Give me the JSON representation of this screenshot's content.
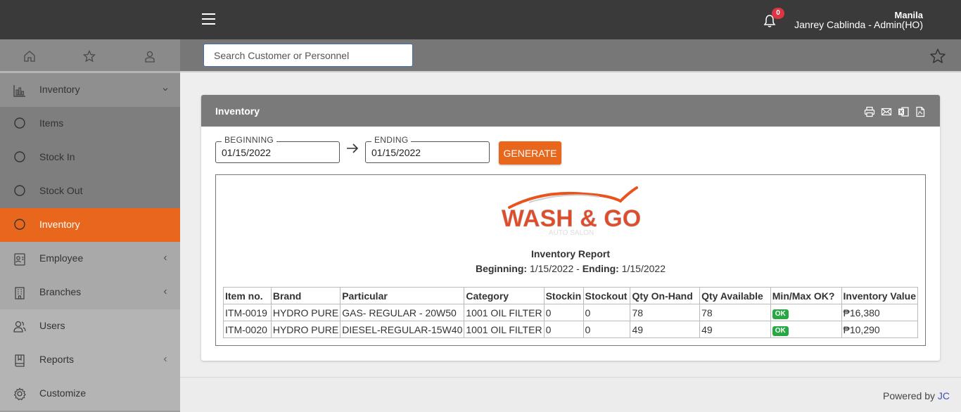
{
  "header": {
    "notification_count": "0",
    "user_city": "Manila",
    "user_name": "Janrey Cablinda - Admin(HO)",
    "menu_icon": "hamburger-menu-icon",
    "bell_icon": "bell-icon"
  },
  "search": {
    "placeholder": "Search Customer or Personnel",
    "value": ""
  },
  "sidebar": {
    "top_icons": [
      "home-icon",
      "star-icon",
      "user-icon"
    ],
    "items": [
      {
        "label": "Inventory",
        "icon": "chart-icon",
        "expanded": true
      },
      {
        "label": "Items",
        "icon": "circle-icon"
      },
      {
        "label": "Stock In",
        "icon": "circle-icon"
      },
      {
        "label": "Stock Out",
        "icon": "circle-icon"
      },
      {
        "label": "Inventory",
        "icon": "circle-icon",
        "active": true
      },
      {
        "label": "Employee",
        "icon": "employee-badge-icon"
      },
      {
        "label": "Branches",
        "icon": "building-icon"
      },
      {
        "label": "Users",
        "icon": "users-icon"
      },
      {
        "label": "Reports",
        "icon": "book-icon"
      },
      {
        "label": "Customize",
        "icon": "gear-icon"
      }
    ]
  },
  "card": {
    "title": "Inventory",
    "toolbar_icons": [
      "print-icon",
      "email-icon",
      "excel-icon",
      "pdf-icon"
    ]
  },
  "filters": {
    "beginning_label": "BEGINNING",
    "beginning_value": "01/15/2022",
    "ending_label": "ENDING",
    "ending_value": "01/15/2022",
    "generate_label": "GENERATE"
  },
  "report": {
    "logo_text": "WASH & GO",
    "logo_subtext": "AUTO SALON",
    "title": "Inventory Report",
    "beginning_label": "Beginning:",
    "beginning_value": "1/15/2022",
    "separator": "-",
    "ending_label": "Ending:",
    "ending_value": "1/15/2022",
    "columns": [
      "Item no.",
      "Brand",
      "Particular",
      "Category",
      "Stockin",
      "Stockout",
      "Qty On-Hand",
      "Qty Available",
      "Min/Max OK?",
      "Inventory Value"
    ],
    "rows": [
      [
        "ITM-0019",
        "HYDRO PURE",
        "GAS- REGULAR - 20W50",
        "1001 OIL FILTER",
        "0",
        "0",
        "78",
        "78",
        "OK",
        "₱16,380"
      ],
      [
        "ITM-0020",
        "HYDRO PURE",
        "DIESEL-REGULAR-15W40",
        "1001 OIL FILTER",
        "0",
        "0",
        "49",
        "49",
        "OK",
        "₱10,290"
      ]
    ]
  },
  "footer": {
    "powered_text": "Powered by",
    "powered_link": "JC"
  },
  "colors": {
    "accent": "#e8671c",
    "topbar": "#3a3a3a",
    "ok_badge": "#28a745",
    "badge": "#dc3545"
  }
}
